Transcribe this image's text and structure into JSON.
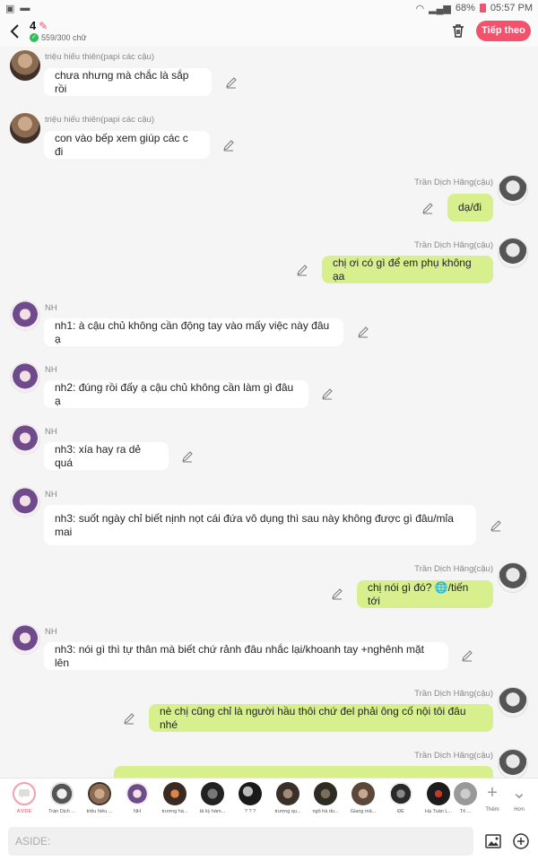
{
  "status_bar": {
    "battery": "68%",
    "time": "05:57 PM"
  },
  "header": {
    "title": "4",
    "char_count": "559/300 chữ",
    "next_label": "Tiếp theo"
  },
  "messages": [
    {
      "side": "in",
      "sender": "triệu hiếu thiên(papi các cậu)",
      "avatar": "tht",
      "text": "chưa nhưng mà chắc là sắp rồi"
    },
    {
      "side": "in",
      "sender": "triệu hiếu thiên(papi các cậu)",
      "avatar": "tht",
      "text": "con vào bếp xem giúp các c đi"
    },
    {
      "side": "out",
      "sender": "Trần Dịch Hãng(cậu)",
      "avatar": "tdh",
      "text": "dạ/đi"
    },
    {
      "side": "out",
      "sender": "Trần Dịch Hãng(cậu)",
      "avatar": "tdh",
      "text": "chị ơi có gì để em phụ không ạa"
    },
    {
      "side": "in",
      "sender": "NH",
      "avatar": "nh",
      "text": "nh1: à cậu chủ không cần động tay vào mấy việc này đâu ạ"
    },
    {
      "side": "in",
      "sender": "NH",
      "avatar": "nh",
      "text": "nh2: đúng rồi đấy ạ cậu chủ không cần làm gì đâu ạ"
    },
    {
      "side": "in",
      "sender": "NH",
      "avatar": "nh",
      "text": "nh3: xía hay ra dẻ quá"
    },
    {
      "side": "in",
      "sender": "NH",
      "avatar": "nh",
      "text": "nh3: suốt ngày chỉ biết nịnh nọt cái đứa vô dụng thì sau này không được gì đâu/mỉa mai"
    },
    {
      "side": "out",
      "sender": "Trần Dịch Hãng(cậu)",
      "avatar": "tdh",
      "text": "chị nói gì đó? 🌐/tiến tới"
    },
    {
      "side": "in",
      "sender": "NH",
      "avatar": "nh",
      "text": "nh3: nói gì thì tự thân mà biết chứ rảnh đâu nhắc lại/khoanh tay +nghênh mặt lên"
    },
    {
      "side": "out",
      "sender": "Trần Dịch Hãng(cậu)",
      "avatar": "tdh",
      "text": "nè chị cũng chỉ là người hầu thôi chứ đel phải ông cố nội tôi đâu nhé"
    },
    {
      "side": "out",
      "sender": "Trần Dịch Hãng(cậu)",
      "avatar": "tdh",
      "text": ""
    }
  ],
  "characters": [
    {
      "label": "ASIDE"
    },
    {
      "label": "Trần Dịch ..."
    },
    {
      "label": "triệu hiếu ..."
    },
    {
      "label": "NH"
    },
    {
      "label": "trương hà..."
    },
    {
      "label": "tả kỳ hàm..."
    },
    {
      "label": "? ? ?"
    },
    {
      "label": "trương qu..."
    },
    {
      "label": "ngô hà du..."
    },
    {
      "label": "Giang mẫ..."
    },
    {
      "label": "ĐE"
    },
    {
      "label": "Hạ Tuấn L..."
    },
    {
      "label": "Tô ..."
    }
  ],
  "more": {
    "add_label": "Thêm",
    "more_label": "Hơn"
  },
  "input": {
    "placeholder": "ASIDE:"
  }
}
